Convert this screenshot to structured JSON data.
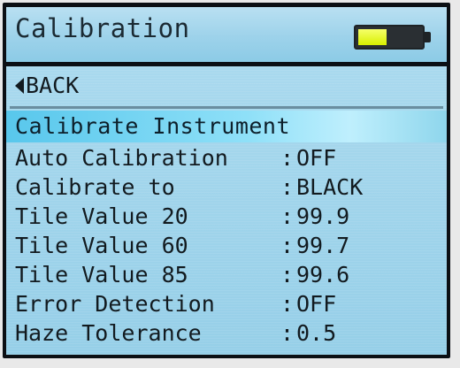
{
  "header": {
    "title": "Calibration",
    "battery_level": 0.45,
    "battery_color": "#e8f700"
  },
  "nav": {
    "back_label": "BACK"
  },
  "section": {
    "title": "Calibrate Instrument"
  },
  "settings": [
    {
      "label": "Auto Calibration",
      "value": "OFF"
    },
    {
      "label": "Calibrate to",
      "value": "BLACK"
    },
    {
      "label": "Tile Value 20",
      "value": "99.9"
    },
    {
      "label": "Tile Value 60",
      "value": "99.7"
    },
    {
      "label": "Tile Value 85",
      "value": "99.6"
    },
    {
      "label": "Error Detection",
      "value": "OFF"
    },
    {
      "label": "Haze Tolerance",
      "value": "0.5"
    }
  ],
  "separator": ":"
}
